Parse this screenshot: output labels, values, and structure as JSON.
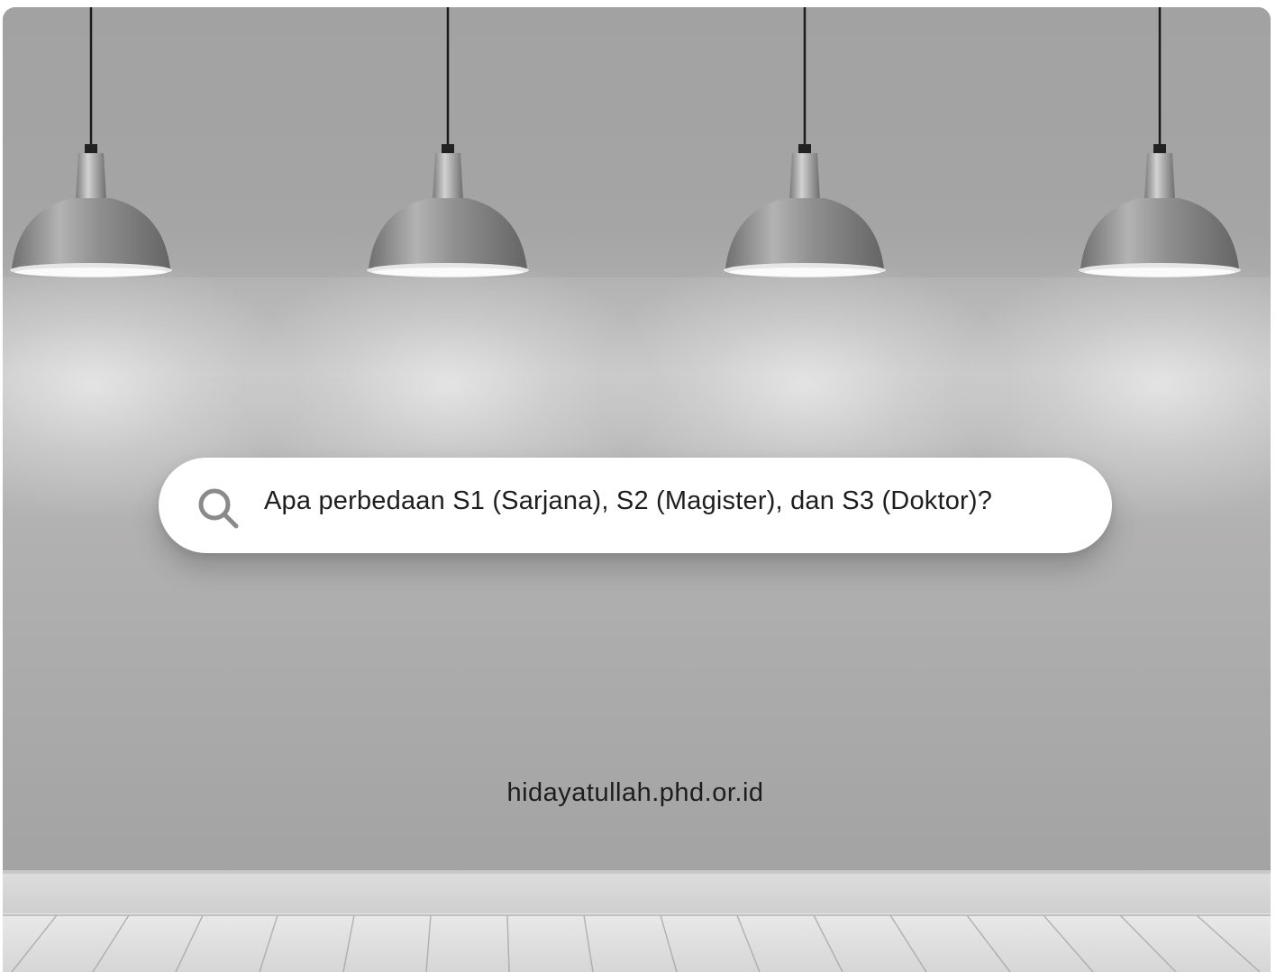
{
  "search": {
    "query": "Apa perbedaan S1 (Sarjana), S2 (Magister), dan S3 (Doktor)?",
    "icon": "search-icon"
  },
  "footer": {
    "site": "hidayatullah.phd.or.id"
  },
  "scene": {
    "lamp_count": 4,
    "colors": {
      "wall": "#a9a9a9",
      "lamp_metal": "#8c8c8c",
      "floor": "#e2e2e2",
      "text": "#1e1e1e"
    }
  }
}
